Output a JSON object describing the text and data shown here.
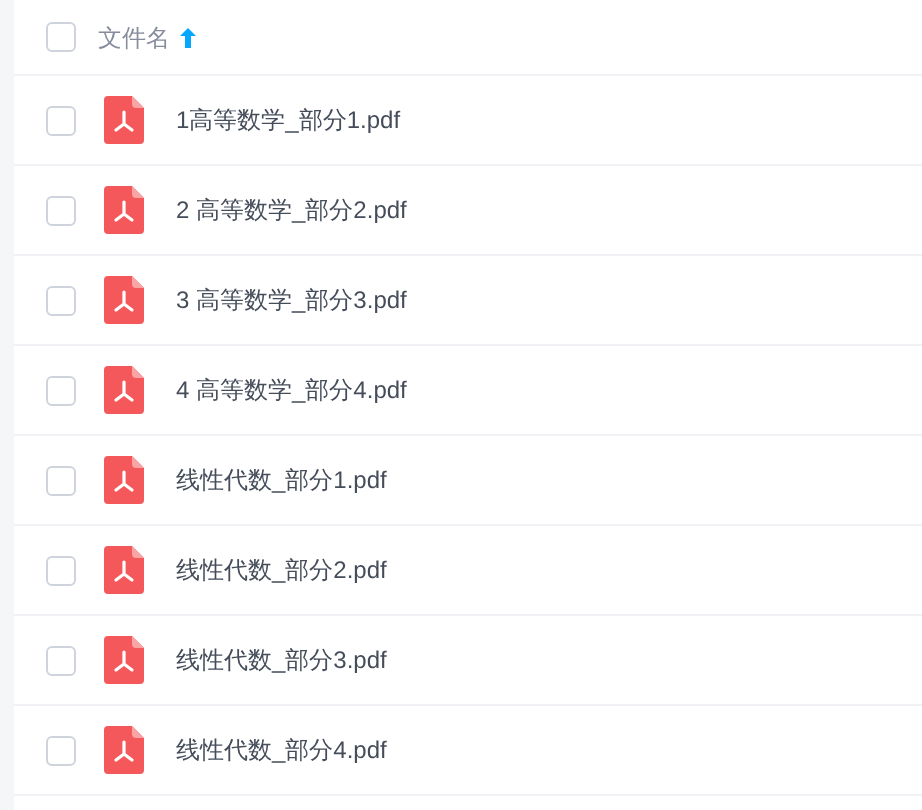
{
  "header": {
    "label": "文件名",
    "checked": false,
    "sort_ascending": true
  },
  "files": [
    {
      "name": "1高等数学_部分1.pdf",
      "checked": false
    },
    {
      "name": "2 高等数学_部分2.pdf",
      "checked": false
    },
    {
      "name": "3 高等数学_部分3.pdf",
      "checked": false
    },
    {
      "name": "4 高等数学_部分4.pdf",
      "checked": false
    },
    {
      "name": "线性代数_部分1.pdf",
      "checked": false
    },
    {
      "name": "线性代数_部分2.pdf",
      "checked": false
    },
    {
      "name": "线性代数_部分3.pdf",
      "checked": false
    },
    {
      "name": "线性代数_部分4.pdf",
      "checked": false
    }
  ]
}
